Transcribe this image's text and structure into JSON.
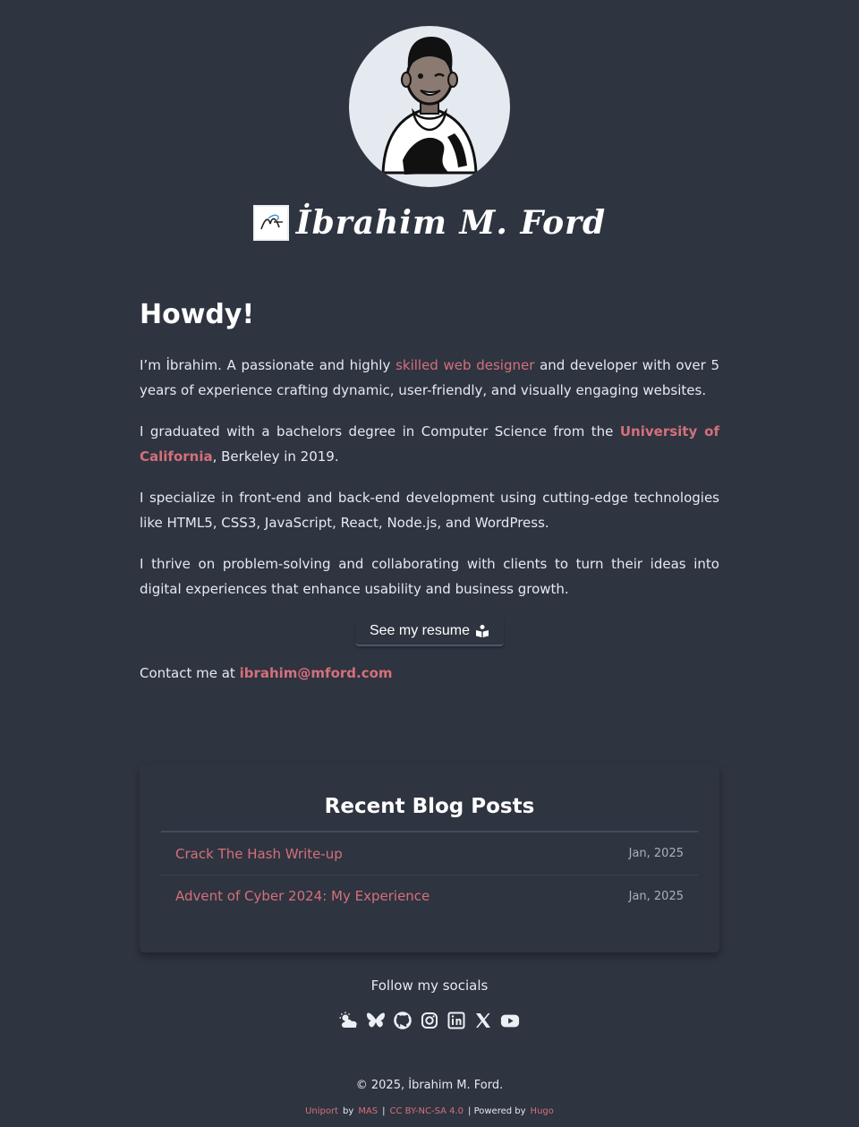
{
  "header": {
    "site_name": "İbrahim M. Ford",
    "logo_text": "MF"
  },
  "intro": {
    "greeting": "Howdy!",
    "p1_before": "I’m İbrahim. A passionate and highly ",
    "p1_link": "skilled web designer",
    "p1_after": " and developer with over 5 years of experience crafting dynamic, user-friendly, and visually engaging websites.",
    "p2_before": "I graduated with a bachelors degree in Computer Science from the ",
    "p2_link": "University of California",
    "p2_after": ", Berkeley in 2019.",
    "p3": "I specialize in front-end and back-end development using cutting-edge technologies like HTML5, CSS3, JavaScript, React, Node.js, and WordPress.",
    "p4": "I thrive on problem-solving and collaborating with clients to turn their ideas into digital experiences that enhance usability and business growth.",
    "resume_label": "See my resume",
    "contact_prefix": "Contact me at ",
    "contact_email": "ibrahim@mford.com"
  },
  "blog": {
    "title": "Recent Blog Posts",
    "posts": [
      {
        "title": "Crack The Hash Write-up",
        "date": "Jan, 2025"
      },
      {
        "title": "Advent of Cyber 2024: My Experience",
        "date": "Jan, 2025"
      }
    ]
  },
  "socials": {
    "heading": "Follow my socials",
    "icons": [
      "weather-icon",
      "bluesky-icon",
      "github-icon",
      "instagram-icon",
      "linkedin-icon",
      "x-icon",
      "youtube-icon"
    ]
  },
  "footer": {
    "copyright": "© 2025, İbrahim M. Ford.",
    "theme": "Uniport",
    "by": "by",
    "author": "MAS",
    "divider": "|",
    "license": "CC BY-NC-SA 4.0",
    "powered": "| Powered by",
    "engine": "Hugo"
  },
  "colors": {
    "background": "#2e3440",
    "accent": "#d4707a",
    "text": "#eceff4"
  }
}
